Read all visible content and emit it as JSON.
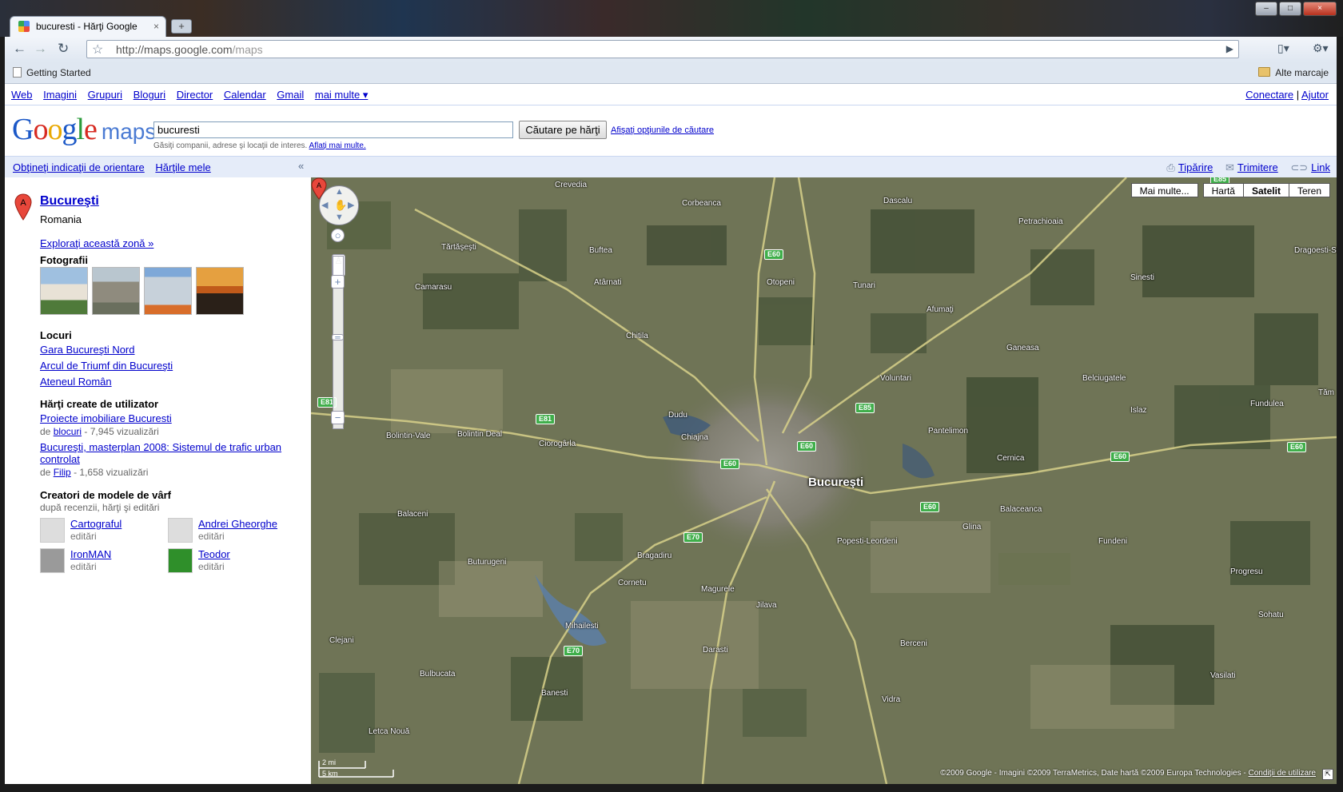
{
  "browser": {
    "tab_title": "bucuresti - Hărţi Google",
    "tab_close": "×",
    "new_tab": "+",
    "url_host": "http://maps.google.com",
    "url_path": "/maps",
    "bookmark": "Getting Started",
    "other_bookmarks": "Alte marcaje"
  },
  "gbar": {
    "links": [
      "Web",
      "Imagini",
      "Grupuri",
      "Bloguri",
      "Director",
      "Calendar",
      "Gmail",
      "mai multe ▾"
    ],
    "connect": "Conectare",
    "separator": "|",
    "help": "Ajutor"
  },
  "header": {
    "logo_maps": "maps",
    "search_value": "bucuresti",
    "search_button": "Căutare pe hărţi",
    "search_options": "Afişaţi opţiunile de căutare",
    "hint": "Găsiţi companii, adrese şi locaţii de interes.",
    "hint_link": "Aflaţi mai multe."
  },
  "subbar": {
    "directions": "Obţineţi indicaţii de orientare",
    "my_maps": "Hărţile mele",
    "collapse": "«",
    "print": "Tipărire",
    "send": "Trimitere",
    "link": "Link"
  },
  "sidebar": {
    "pin_letter": "A",
    "result_title": "Bucureşti",
    "result_country": "Romania",
    "explore": "Exploraţi această zonă »",
    "photos_heading": "Fotografii",
    "places_heading": "Locuri",
    "places": [
      "Gara Bucureşti Nord",
      "Arcul de Triumf din Bucureşti",
      "Ateneul Român"
    ],
    "user_maps_heading": "Hărţi create de utilizator",
    "user_maps": [
      {
        "title": "Proiecte imobiliare Bucuresti",
        "by": "de",
        "author": "blocuri",
        "views": "- 7,945 vizualizări"
      },
      {
        "title": "Bucureşti, masterplan 2008: Sistemul de trafic urban controlat",
        "by": "de",
        "author": "Filip",
        "views": "- 1,658 vizualizări"
      }
    ],
    "creators_heading": "Creatori de modele de vârf",
    "creators_sub": "după recenzii, hărţi şi editări",
    "creators": [
      {
        "name": "Cartograful",
        "sub": "editări"
      },
      {
        "name": "Andrei Gheorghe",
        "sub": "editări"
      },
      {
        "name": "IronMAN",
        "sub": "editări"
      },
      {
        "name": "Teodor",
        "sub": "editări"
      }
    ]
  },
  "map": {
    "map_types": {
      "more": "Mai multe...",
      "map": "Hartă",
      "satellite": "Satelit",
      "terrain": "Teren"
    },
    "selected_type": "Satelit",
    "main_label": "Bucureşti",
    "main_pin": "A",
    "scale_mi": "2 mi",
    "scale_km": "5 km",
    "copyright": "©2009 Google - Imagini ©2009 TerraMetrics, Date hartă ©2009 Europa Technologies -",
    "terms": "Condiţii de utilizare",
    "places": [
      "Crevedia",
      "Corbeanca",
      "Dascalu",
      "Petrachioaia",
      "Tărtăşeşti",
      "Buftea",
      "Dragoesti-Sn",
      "Otopeni",
      "Tunari",
      "Atârnati",
      "Camarasu",
      "Sinesti",
      "Afumaţi",
      "Chitila",
      "Ganeasa",
      "Voluntari",
      "Belciugatele",
      "Fundulea",
      "Islaz",
      "Tăm",
      "Dudu",
      "Chiajna",
      "Bolintin-Vale",
      "Bolintin Deal",
      "Ciorogârla",
      "Pantelimon",
      "Cernica",
      "Balaceanca",
      "Glina",
      "Balaceni",
      "Popesti-Leordeni",
      "Fundeni",
      "Progresu",
      "Buturugeni",
      "Bragadiru",
      "Cornetu",
      "Magurele",
      "Jilava",
      "Mihailesti",
      "Sohatu",
      "Clejani",
      "Darasti",
      "Berceni",
      "Bulbucata",
      "Vasilati",
      "Banesti",
      "Vidra",
      "Letca Nouă"
    ],
    "highways": [
      "E60",
      "E85",
      "E81",
      "E81",
      "E60",
      "E85",
      "E60",
      "E60",
      "E60",
      "E70",
      "E70",
      "E85"
    ]
  }
}
